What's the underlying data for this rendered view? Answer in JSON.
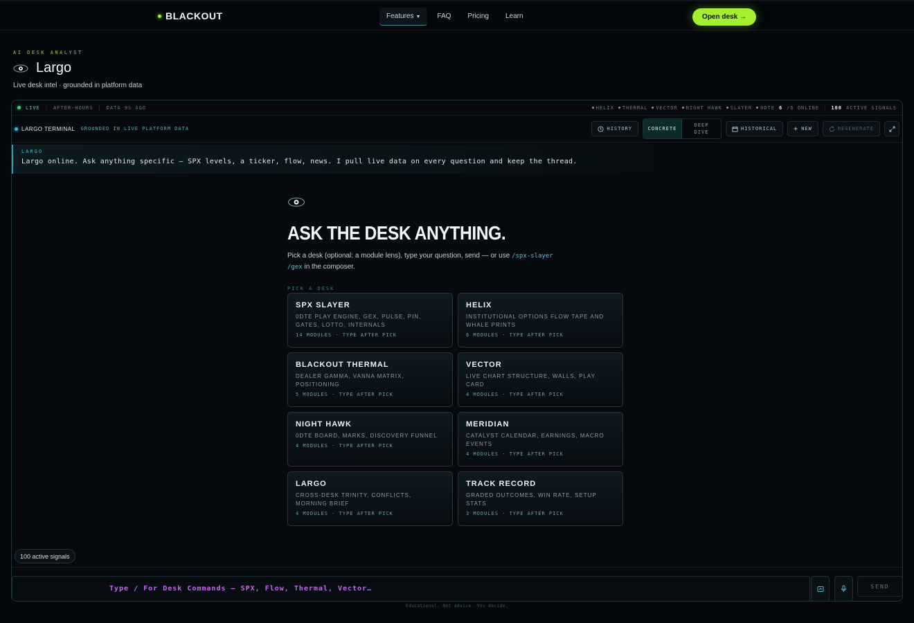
{
  "nav": {
    "brand": "BLACKOUT",
    "links": [
      "Features",
      "FAQ",
      "Pricing",
      "Learn"
    ],
    "cta": "Open desk →"
  },
  "header": {
    "eyebrow": "AI DESK ANALYST",
    "title": "Largo",
    "subtitle": "Live desk intel · grounded in platform data"
  },
  "status": {
    "live": "LIVE",
    "session": "AFTER-HOURS",
    "freshness": "DATA 9S AGO",
    "desks": [
      "HELIX",
      "THERMAL",
      "VECTOR",
      "NIGHT HAWK",
      "SLAYER",
      "0DTE"
    ],
    "online_count": "6",
    "online_label": "/6 ONLINE",
    "signals_count": "100",
    "signals_label": "ACTIVE SIGNALS"
  },
  "toolbar": {
    "name": "LARGO TERMINAL",
    "sub": "GROUNDED IN LIVE PLATFORM DATA",
    "history": "HISTORY",
    "mode_concrete": "CONCRETE",
    "mode_deep": "DEEP DIVE",
    "historical": "HISTORICAL",
    "new": "NEW",
    "regenerate": "REGENERATE"
  },
  "welcome": {
    "tag": "LARGO",
    "text": "Largo online. Ask anything specific — SPX levels, a ticker, flow, news. I pull live data on every question and keep the thread."
  },
  "center": {
    "headline": "ASK THE DESK ANYTHING.",
    "intro_a": "Pick a desk (optional: a module lens), type your question, send — or use ",
    "cmd1": "/spx-slayer",
    "cmd2": "/gex",
    "intro_b": " in the composer.",
    "pick_label": "PICK A DESK"
  },
  "desks": [
    {
      "title": "SPX SLAYER",
      "desc": "0DTE play engine, GEX, pulse, pin, gates, lotto, internals",
      "meta": "14 MODULES · TYPE AFTER PICK"
    },
    {
      "title": "HELIX",
      "desc": "Institutional options flow tape and whale prints",
      "meta": "6 MODULES · TYPE AFTER PICK"
    },
    {
      "title": "BLACKOUT THERMAL",
      "desc": "Dealer gamma, vanna matrix, positioning",
      "meta": "5 MODULES · TYPE AFTER PICK"
    },
    {
      "title": "VECTOR",
      "desc": "Live chart structure, walls, play card",
      "meta": "4 MODULES · TYPE AFTER PICK"
    },
    {
      "title": "NIGHT HAWK",
      "desc": "0DTE board, marks, discovery funnel",
      "meta": "4 MODULES · TYPE AFTER PICK"
    },
    {
      "title": "MERIDIAN",
      "desc": "Catalyst calendar, earnings, macro events",
      "meta": "4 MODULES · TYPE AFTER PICK"
    },
    {
      "title": "LARGO",
      "desc": "Cross-desk trinity, conflicts, morning brief",
      "meta": "4 MODULES · TYPE AFTER PICK"
    },
    {
      "title": "TRACK RECORD",
      "desc": "Graded outcomes, win rate, setup stats",
      "meta": "3 MODULES · TYPE AFTER PICK"
    }
  ],
  "signals_pill": "100 active signals",
  "composer": {
    "placeholder": "Type / For Desk Commands — SPX, Flow, Thermal, Vector…",
    "send": "SEND"
  },
  "disclaimer": "Educational. Not advice. You decide.",
  "colors": {
    "accent_green": "#a6ee2e",
    "accent_cyan": "#2c9fb0",
    "composer_placeholder": "#c46ae8",
    "background": "#05080c"
  },
  "icons": [
    "eye-logo-icon",
    "history-icon",
    "calendar-icon",
    "plus-icon",
    "regenerate-icon",
    "expand-icon",
    "attach-icon",
    "mic-icon"
  ]
}
